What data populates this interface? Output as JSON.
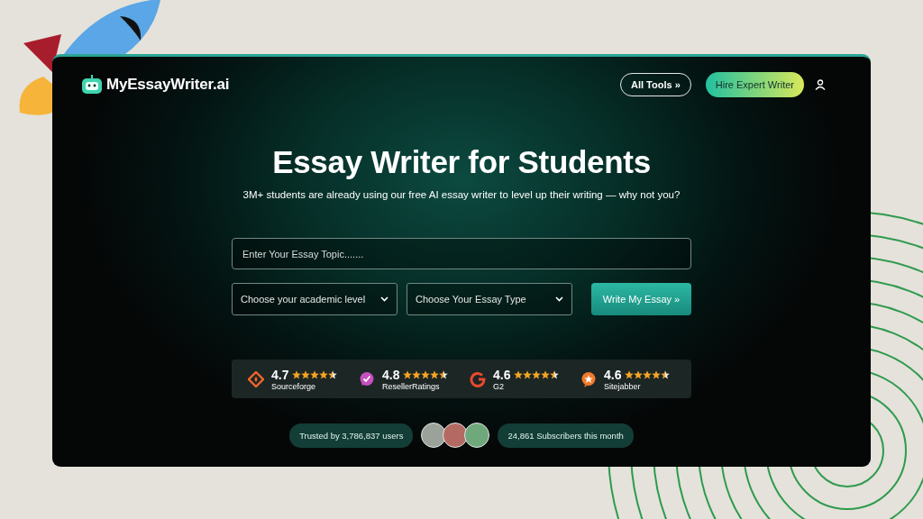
{
  "header": {
    "logo": "MyEssayWriter.ai",
    "all_tools": "All Tools »",
    "hire_button": "Hire Expert Writer"
  },
  "hero": {
    "title": "Essay Writer for Students",
    "subtitle": "3M+ students are already using our free AI essay writer to level up their writing — why not you?"
  },
  "form": {
    "topic": {
      "placeholder": "Enter Your Essay Topic......."
    },
    "academic_level": {
      "placeholder": "Choose your academic level"
    },
    "essay_type": {
      "placeholder": "Choose Your Essay Type"
    },
    "submit": "Write My Essay »"
  },
  "ratings": [
    {
      "kind": "diamond",
      "color": "#f0672a",
      "score": "4.7",
      "stars": 4.5,
      "source": "Sourceforge"
    },
    {
      "kind": "check",
      "color": "#c64fbe",
      "score": "4.8",
      "stars": 4.5,
      "source": "ResellerRatings"
    },
    {
      "kind": "letter",
      "color": "#e8492f",
      "score": "4.6",
      "stars": 4.5,
      "source": "G2"
    },
    {
      "kind": "star",
      "color": "#f07a2a",
      "score": "4.6",
      "stars": 4.5,
      "source": "Sitejabber"
    }
  ],
  "trust": {
    "users": "Trusted by 3,786,837 users",
    "subscribers": "24,861 Subscribers this month"
  }
}
